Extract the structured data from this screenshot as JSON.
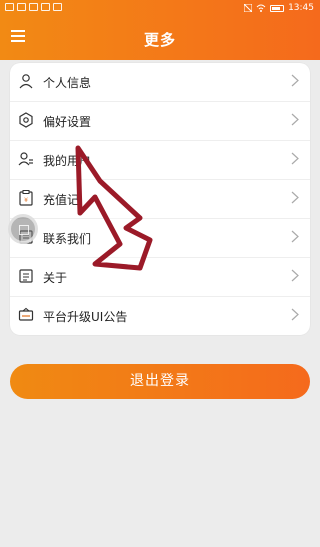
{
  "status_bar": {
    "time": "13:45",
    "left_icons": [
      "sim-icon",
      "signal-icon",
      "wifi-icon",
      "video-icon",
      "message-icon"
    ],
    "right_icons": [
      "mute-icon",
      "wifi-status-icon",
      "battery-icon"
    ]
  },
  "header": {
    "title": "更多",
    "menu_icon": "hamburger-icon"
  },
  "menu": {
    "items": [
      {
        "label": "个人信息",
        "icon": "person-icon"
      },
      {
        "label": "偏好设置",
        "icon": "settings-icon"
      },
      {
        "label": "我的用户",
        "icon": "users-icon"
      },
      {
        "label": "充值记",
        "icon": "recharge-icon"
      },
      {
        "label": "联系我们",
        "icon": "contact-icon"
      },
      {
        "label": "关于",
        "icon": "about-icon"
      },
      {
        "label": "平台升级UI公告",
        "icon": "announcement-icon"
      }
    ]
  },
  "logout": {
    "label": "退出登录"
  },
  "colors": {
    "accent": "#f27a18",
    "annotation": "#9b1a28",
    "background": "#ececec"
  }
}
